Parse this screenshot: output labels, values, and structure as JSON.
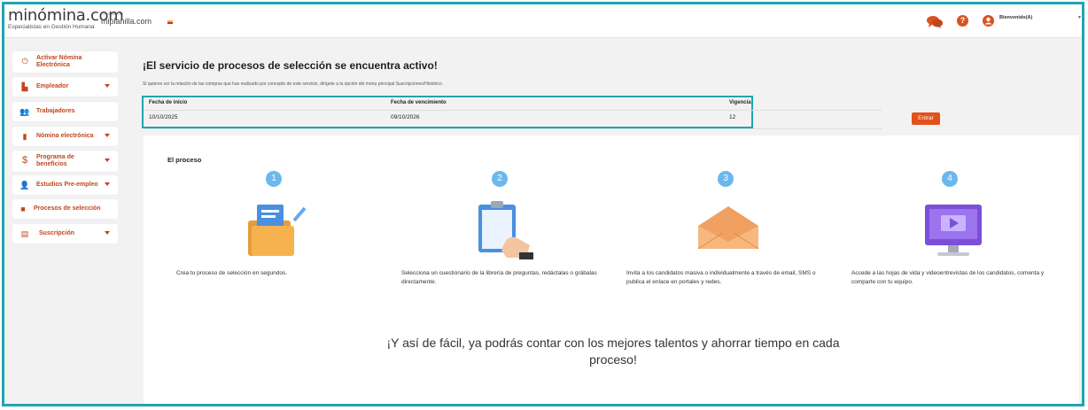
{
  "header": {
    "logo_text": "minómina.com",
    "logo_subtitle": "Especialistas en Gestión Humana",
    "powered_by": "POWERED BY",
    "partner": "miplanilla.com",
    "welcome": "Bienvenido(A)",
    "icons": [
      "chat-icon",
      "help-icon",
      "user-icon"
    ],
    "accent_color": "#d9531e"
  },
  "sidebar": {
    "items": [
      {
        "label": "Activar Nómina Electrónica",
        "icon": "power-icon",
        "caret": false
      },
      {
        "label": "Empleador",
        "icon": "building-icon",
        "caret": true
      },
      {
        "label": "Trabajadores",
        "icon": "users-icon",
        "caret": false
      },
      {
        "label": "Nómina electrónica",
        "icon": "document-icon",
        "caret": true
      },
      {
        "label": "Programa de beneficios",
        "icon": "dollar-icon",
        "caret": true
      },
      {
        "label": "Estudios Pre-empleo",
        "icon": "user-plus-icon",
        "caret": true
      },
      {
        "label": "Procesos de selección",
        "icon": "video-icon",
        "caret": false
      },
      {
        "label": "Suscripción",
        "icon": "card-icon",
        "caret": true
      }
    ]
  },
  "main": {
    "title": "¡El servicio de procesos de selección se encuentra activo!",
    "subtitle": "Si quieres ver la relación de las compras que has realizado por concepto de este servicio, dirígete a la opción del menu principal Suscripciones/Histórico.",
    "table": {
      "headers": [
        "Fecha de inicio",
        "Fecha de vencimiento",
        "Vigencia"
      ],
      "row": [
        "10/10/2025",
        "09/10/2026",
        "12"
      ]
    },
    "enter_button": "Entrar"
  },
  "process": {
    "title": "El proceso",
    "steps": [
      {
        "number": "1",
        "icon": "folder-documents-icon",
        "text": "Crea tu proceso de selección en segundos."
      },
      {
        "number": "2",
        "icon": "clipboard-hand-icon",
        "text": "Selecciona un cuestionario de la librería de preguntas, redáctalas o grábalas directamente."
      },
      {
        "number": "3",
        "icon": "envelope-icon",
        "text": "Invita a los candidatos masiva o individualmente a través de email, SMS o publica el enlace en portales y redes."
      },
      {
        "number": "4",
        "icon": "monitor-video-icon",
        "text": "Accede a las hojas de vida y videoentrevistas de los candidatos, comenta y comparte con tu equipo."
      }
    ],
    "tagline": "¡Y así de fácil, ya podrás contar con los mejores talentos y ahorrar tiempo en cada proceso!"
  }
}
